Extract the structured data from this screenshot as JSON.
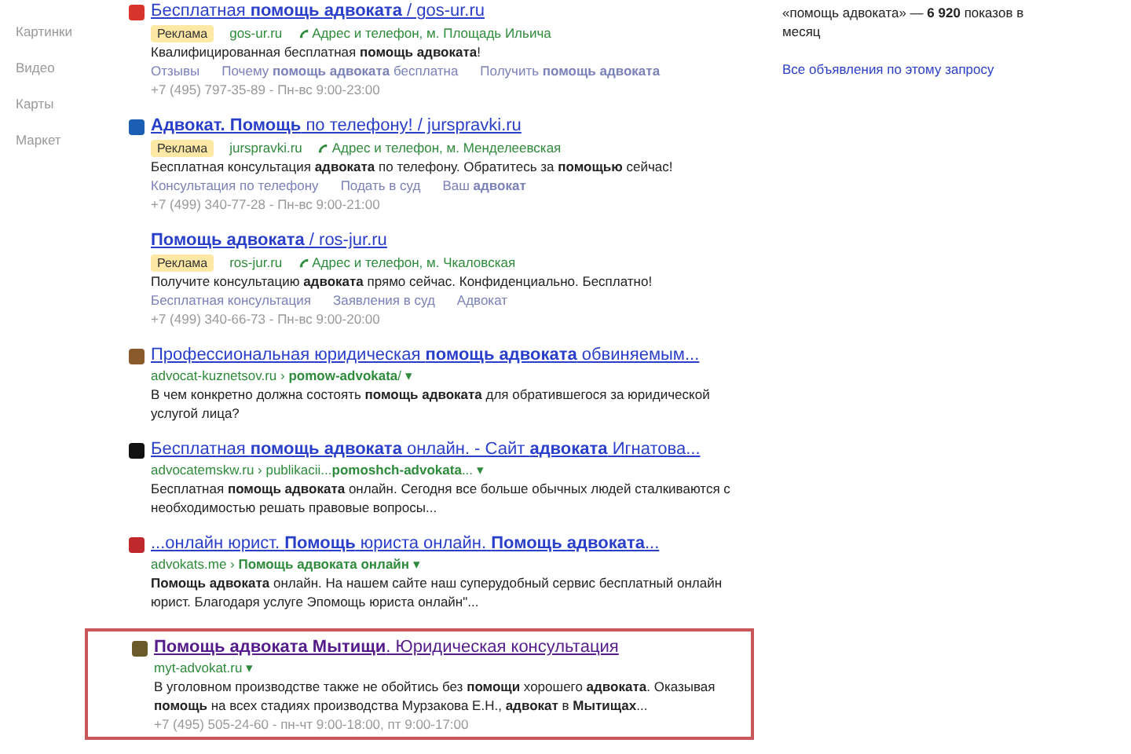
{
  "nav": [
    {
      "label": "Картинки"
    },
    {
      "label": "Видео"
    },
    {
      "label": "Карты"
    },
    {
      "label": "Маркет"
    }
  ],
  "results": [
    {
      "kind": "ad",
      "color": "#d9342b",
      "highlighted": false,
      "visited": false,
      "title": "Бесплатная **помощь адвоката** / gos-ur.ru",
      "badge": "Реклама",
      "domain": "gos-ur.ru",
      "address": "Адрес и телефон, м. Площадь Ильича",
      "text": "Квалифицированная бесплатная **помощь адвоката**!",
      "links": [
        "Отзывы",
        "Почему **помощь адвоката** бесплатна",
        "Получить **помощь адвоката**"
      ],
      "contact": "+7 (495) 797-35-89 - Пн-вс 9:00-23:00"
    },
    {
      "kind": "ad",
      "color": "#1a5fb4",
      "highlighted": false,
      "visited": false,
      "title": "**Адвокат. Помощь** по телефону! / jurspravki.ru",
      "badge": "Реклама",
      "domain": "jurspravki.ru",
      "address": "Адрес и телефон, м. Менделеевская",
      "text": "Бесплатная консультация **адвоката** по телефону. Обратитесь за **помощью** сейчас!",
      "links": [
        "Консультация по телефону",
        "Подать в суд",
        "Ваш **адвокат**"
      ],
      "contact": "+7 (499) 340-77-28 - Пн-вс 9:00-21:00"
    },
    {
      "kind": "ad",
      "highlighted": false,
      "visited": false,
      "title": "**Помощь адвоката** / ros-jur.ru",
      "badge": "Реклама",
      "domain": "ros-jur.ru",
      "address": "Адрес и телефон, м. Чкаловская",
      "text": "Получите консультацию **адвоката** прямо сейчас. Конфиденциально. Бесплатно!",
      "links": [
        "Бесплатная консультация",
        "Заявления в суд",
        "Адвокат"
      ],
      "contact": "+7 (499) 340-66-73 - Пн-вс 9:00-20:00"
    },
    {
      "kind": "organic",
      "color": "#8a5a2b",
      "highlighted": false,
      "visited": false,
      "title": "Профессиональная юридическая **помощь адвоката** обвиняемым...",
      "url": "advocat-kuznetsov.ru › **pomow-advokata**/ ▾",
      "text": "В чем конкретно должна состоять **помощь адвоката** для обратившегося за юридической услугой лица?"
    },
    {
      "kind": "organic",
      "color": "#111111",
      "highlighted": false,
      "visited": false,
      "title": "Бесплатная **помощь адвоката** онлайн. - Сайт **адвоката** Игнатова...",
      "url": "advocatemskw.ru › publikacii...**pomoshch-advokata**... ▾",
      "text": "Бесплатная **помощь адвоката** онлайн. Сегодня все больше обычных людей сталкиваются с необходимостью решать правовые вопросы..."
    },
    {
      "kind": "organic",
      "color": "#c0282d",
      "highlighted": false,
      "visited": false,
      "title": "...онлайн юрист. **Помощь** юриста онлайн. **Помощь адвоката**...",
      "url": "advokats.me › **Помощь адвоката онлайн** ▾",
      "text": "**Помощь адвоката** онлайн. На нашем сайте наш суперудобный сервис бесплатный онлайн юрист. Благодаря услуге Эпомощь юриста онлайн\"..."
    },
    {
      "kind": "organic",
      "color": "#6b5a2a",
      "highlighted": true,
      "visited": true,
      "title": "**Помощь адвоката Мытищи**. Юридическая консультация",
      "url": "myt-advokat.ru ▾",
      "text": "В уголовном производстве также не обойтись без **помощи** хорошего **адвоката**. Оказывая **помощь** на всех стадиях производства Мурзакова Е.Н., **адвокат** в **Мытищах**...",
      "contact": "+7 (495) 505-24-60 - пн-чт 9:00-18:00, пт 9:00-17:00"
    }
  ],
  "sidebar": {
    "stats": "«помощь адвоката» — **6 920** показов в месяц",
    "all_ads_link": "Все объявления по этому запросу"
  }
}
